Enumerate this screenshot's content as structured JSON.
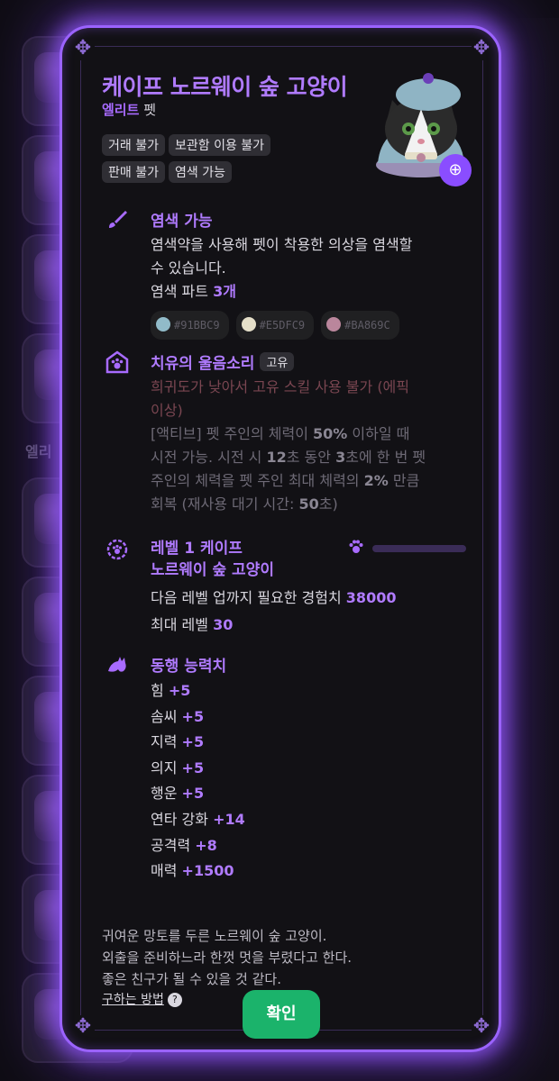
{
  "background": {
    "section_label": "엘리"
  },
  "modal": {
    "title": "케이프 노르웨이 숲 고양이",
    "grade": "엘리트",
    "kind": "펫",
    "tags": [
      "거래 불가",
      "보관함 이용 불가",
      "판매 불가",
      "염색 가능"
    ],
    "pet_image": "cat-with-beret-and-cape-icon",
    "zoom_icon": "zoom-in-icon"
  },
  "dye": {
    "icon": "brush-icon",
    "title": "염색 가능",
    "desc_line1": "염색약을 사용해 펫이 착용한 의상을 염색할",
    "desc_line2": "수 있습니다.",
    "parts_label": "염색 파트",
    "parts_count": "3개",
    "colors": [
      {
        "hex": "#91BBC9",
        "label": "#91BBC9"
      },
      {
        "hex": "#E5DFC9",
        "label": "#E5DFC9"
      },
      {
        "hex": "#BA869C",
        "label": "#BA869C"
      }
    ]
  },
  "skill": {
    "icon": "paw-badge-icon",
    "title": "치유의 울음소리",
    "badge": "고유",
    "warning_line1": "희귀도가 낮아서 고유 스킬 사용 불가 (에픽",
    "warning_line2": "이상)",
    "line1_a": "[액티브] 펫 주인의 체력이 ",
    "line1_b": "50%",
    "line1_c": " 이하일 때",
    "line2_a": "시전 가능. 시전 시 ",
    "line2_b": "12",
    "line2_c": "초 동안 ",
    "line2_d": "3",
    "line2_e": "초에 한 번 펫",
    "line3_a": "주인의 체력을 펫 주인 최대 체력의 ",
    "line3_b": "2%",
    "line3_c": " 만큼",
    "line4_a": "회복 (재사용 대기 시간: ",
    "line4_b": "50",
    "line4_c": "초)"
  },
  "level": {
    "icon": "paw-gear-icon",
    "title_line1": "레벨 1 케이프",
    "title_line2": "노르웨이 숲 고양이",
    "exp_label": "다음 레벨 업까지 필요한 경험치 ",
    "exp_value": "38000",
    "max_label": "최대 레벨 ",
    "max_value": "30",
    "exp_progress": 0
  },
  "stats": {
    "icon": "cat-silhouette-icon",
    "title": "동행 능력치",
    "items": [
      {
        "name": "힘",
        "value": "+5"
      },
      {
        "name": "솜씨",
        "value": "+5"
      },
      {
        "name": "지력",
        "value": "+5"
      },
      {
        "name": "의지",
        "value": "+5"
      },
      {
        "name": "행운",
        "value": "+5"
      },
      {
        "name": "연타 강화",
        "value": "+14"
      },
      {
        "name": "공격력",
        "value": "+8"
      },
      {
        "name": "매력",
        "value": "+1500"
      }
    ]
  },
  "description": {
    "line1": "귀여운 망토를 두른 노르웨이 숲 고양이.",
    "line2": "외출을 준비하느라 한껏 멋을 부렸다고 한다.",
    "line3": "좋은 친구가 될 수 있을 것 같다."
  },
  "footer": {
    "howto_label": "구하는 방법",
    "help_icon": "question-icon",
    "confirm_label": "확인"
  },
  "colors": {
    "accent": "#B07BFF",
    "glow": "#9B63FF",
    "confirm": "#1BB36B",
    "warning": "#7A4651"
  }
}
